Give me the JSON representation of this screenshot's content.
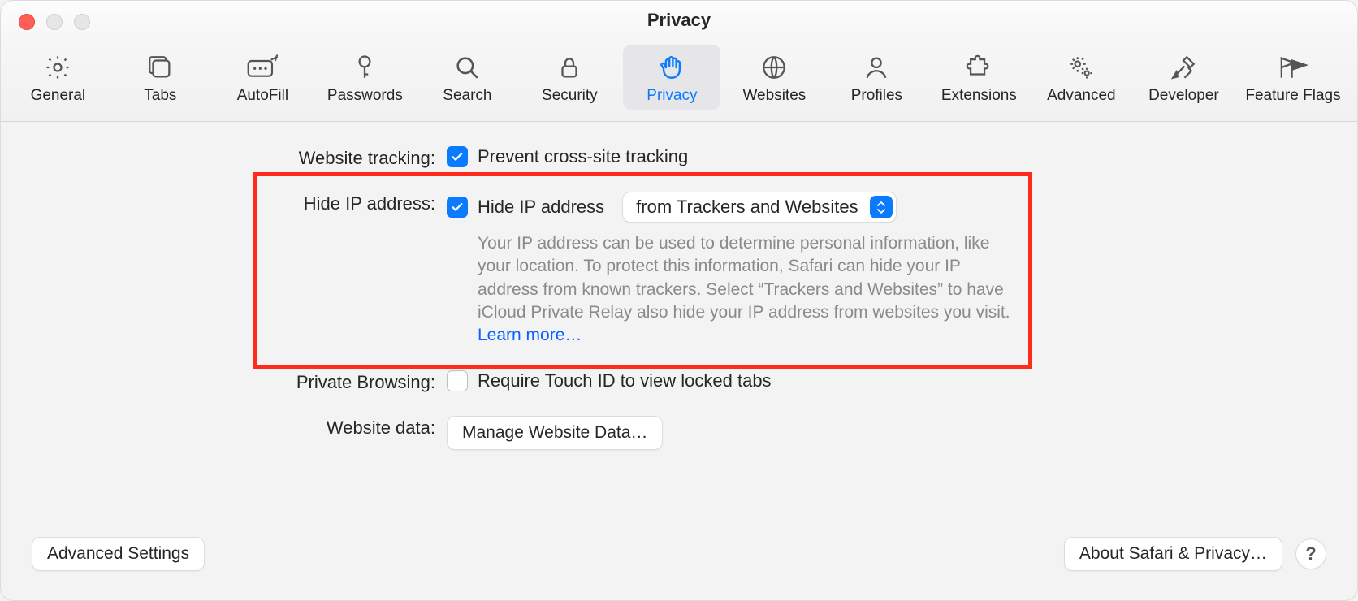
{
  "window": {
    "title": "Privacy"
  },
  "toolbar": {
    "items": [
      {
        "id": "general",
        "label": "General"
      },
      {
        "id": "tabs",
        "label": "Tabs"
      },
      {
        "id": "autofill",
        "label": "AutoFill"
      },
      {
        "id": "passwords",
        "label": "Passwords"
      },
      {
        "id": "search",
        "label": "Search"
      },
      {
        "id": "security",
        "label": "Security"
      },
      {
        "id": "privacy",
        "label": "Privacy",
        "active": true
      },
      {
        "id": "websites",
        "label": "Websites"
      },
      {
        "id": "profiles",
        "label": "Profiles"
      },
      {
        "id": "extensions",
        "label": "Extensions"
      },
      {
        "id": "advanced",
        "label": "Advanced"
      },
      {
        "id": "developer",
        "label": "Developer"
      },
      {
        "id": "flags",
        "label": "Feature Flags"
      }
    ]
  },
  "rows": {
    "tracking": {
      "label": "Website tracking:",
      "checkbox_label": "Prevent cross-site tracking",
      "checked": true
    },
    "hide_ip": {
      "label": "Hide IP address:",
      "checkbox_label": "Hide IP address",
      "checked": true,
      "dropdown_value": "from Trackers and Websites",
      "help": "Your IP address can be used to determine personal information, like your location. To protect this information, Safari can hide your IP address from known trackers. Select “Trackers and Websites” to have iCloud Private Relay also hide your IP address from websites you visit. ",
      "learn_more": "Learn more…"
    },
    "private_browsing": {
      "label": "Private Browsing:",
      "checkbox_label": "Require Touch ID to view locked tabs",
      "checked": false
    },
    "website_data": {
      "label": "Website data:",
      "button": "Manage Website Data…"
    }
  },
  "footer": {
    "advanced_settings": "Advanced Settings",
    "about": "About Safari & Privacy…",
    "help": "?"
  }
}
